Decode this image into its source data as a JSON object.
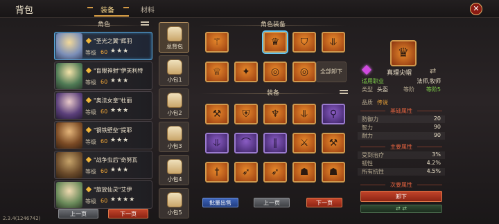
{
  "header": {
    "title": "背包",
    "tabs": [
      {
        "label": "装备",
        "active": true
      },
      {
        "label": "材料",
        "active": false
      }
    ],
    "close_icon": "close-icon"
  },
  "characters": {
    "header": "角色",
    "list": [
      {
        "name": "\"圣光之翼\"辉羽",
        "level_label": "等级",
        "level": "60",
        "stars": "★★★",
        "selected": true
      },
      {
        "name": "\"盲眼神射\"伊芙利特",
        "level_label": "等级",
        "level": "60",
        "stars": "★★★"
      },
      {
        "name": "\"奥法女皇\"杜丽",
        "level_label": "等级",
        "level": "60",
        "stars": "★★★"
      },
      {
        "name": "\"钢铁壁垒\"提耶",
        "level_label": "等级",
        "level": "60",
        "stars": "★★★"
      },
      {
        "name": "\"战争虫后\"奇努瓦",
        "level_label": "等级",
        "level": "60",
        "stars": "★★★"
      },
      {
        "name": "\"旋放仙灵\"艾伊",
        "level_label": "等级",
        "level": "60",
        "stars": "★★★★"
      }
    ],
    "prev_label": "上一页",
    "next_label": "下一页"
  },
  "bags": [
    "总背包",
    "小包1",
    "小包2",
    "小包3",
    "小包4",
    "小包5"
  ],
  "equipped": {
    "header": "角色装备",
    "row1": [
      "staff-icon",
      "crown-icon",
      "robe-icon",
      "boots-icon"
    ],
    "row2": [
      "crown-dark-icon",
      "orb-icon",
      "ring-icon",
      "ring-icon"
    ],
    "unequip_all": "全部卸下"
  },
  "inventory": {
    "header": "装备",
    "rows": [
      [
        {
          "icon": "mace-icon",
          "rarity": "orange"
        },
        {
          "icon": "armor-icon",
          "rarity": "orange"
        },
        {
          "icon": "antler-helm-icon",
          "rarity": "orange"
        },
        {
          "icon": "boots-icon",
          "rarity": "orange"
        },
        {
          "icon": "wand-icon",
          "rarity": "purple"
        }
      ],
      [
        {
          "icon": "boots-icon",
          "rarity": "purple"
        },
        {
          "icon": "hat-icon",
          "rarity": "purple"
        },
        {
          "icon": "greaves-icon",
          "rarity": "purple"
        },
        {
          "icon": "sword-icon",
          "rarity": "orange"
        },
        {
          "icon": "hammer-icon",
          "rarity": "orange"
        }
      ],
      [
        {
          "icon": "dagger-icon",
          "rarity": "orange"
        },
        {
          "icon": "bow-icon",
          "rarity": "orange"
        },
        {
          "icon": "bow-icon",
          "rarity": "orange"
        },
        {
          "icon": "demon-mask-icon",
          "rarity": "orange"
        },
        {
          "icon": "demon-mask-icon",
          "rarity": "orange"
        }
      ]
    ],
    "batch_sell": "批量出售",
    "prev_label": "上一页",
    "next_label": "下一页"
  },
  "detail": {
    "name": "真理尖帽",
    "job_label": "适用职业",
    "job_value": "法师,牧师",
    "type_label": "类型",
    "type_value": "头盔",
    "tier_label": "等阶",
    "tier_value": "等阶5",
    "quality_label": "品质",
    "quality_value": "传说",
    "base_header": "基础属性",
    "base": [
      {
        "k": "防御力",
        "v": "20"
      },
      {
        "k": "智力",
        "v": "90"
      },
      {
        "k": "耐力",
        "v": "90"
      }
    ],
    "main_header": "主要属性",
    "main": [
      {
        "k": "受到治疗",
        "v": "3%"
      },
      {
        "k": "韧性",
        "v": "4.2%"
      },
      {
        "k": "所有抗性",
        "v": "4.5%"
      }
    ],
    "sub_header": "次要属性",
    "unequip": "卸下"
  },
  "version": "2.3.4(1246742)",
  "colors": {
    "accent": "#e0a448",
    "legendary": "#d19a4e",
    "epic": "#9b7bcf",
    "red_button": "#c2442a",
    "green_text": "#7fd14a"
  }
}
